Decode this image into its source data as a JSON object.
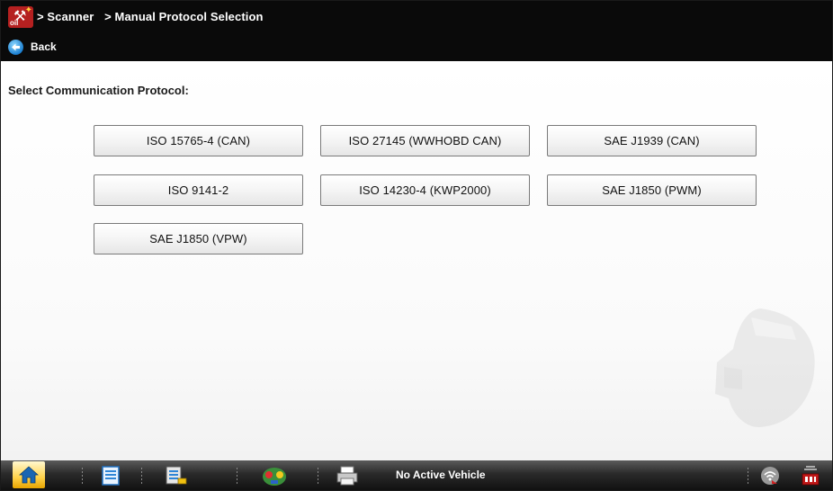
{
  "header": {
    "breadcrumb": [
      "> Scanner",
      "> Manual Protocol Selection"
    ],
    "back_label": "Back"
  },
  "main": {
    "prompt": "Select Communication Protocol:",
    "protocols": [
      "ISO 15765-4 (CAN)",
      "ISO 27145 (WWHOBD CAN)",
      "SAE J1939 (CAN)",
      "ISO 9141-2",
      "ISO 14230-4 (KWP2000)",
      "SAE J1850 (PWM)",
      "SAE J1850 (VPW)"
    ]
  },
  "taskbar": {
    "status": "No Active Vehicle",
    "icons": [
      "home-icon",
      "vehicle-info-icon",
      "vehicle-records-icon",
      "scanner-icon",
      "printer-icon",
      "wireless-icon",
      "battery-icon"
    ]
  },
  "colors": {
    "topbar": "#0a0a0a",
    "accent_red": "#b52020",
    "home_highlight": "#ffd24a",
    "back_blue": "#1b7fd0"
  }
}
